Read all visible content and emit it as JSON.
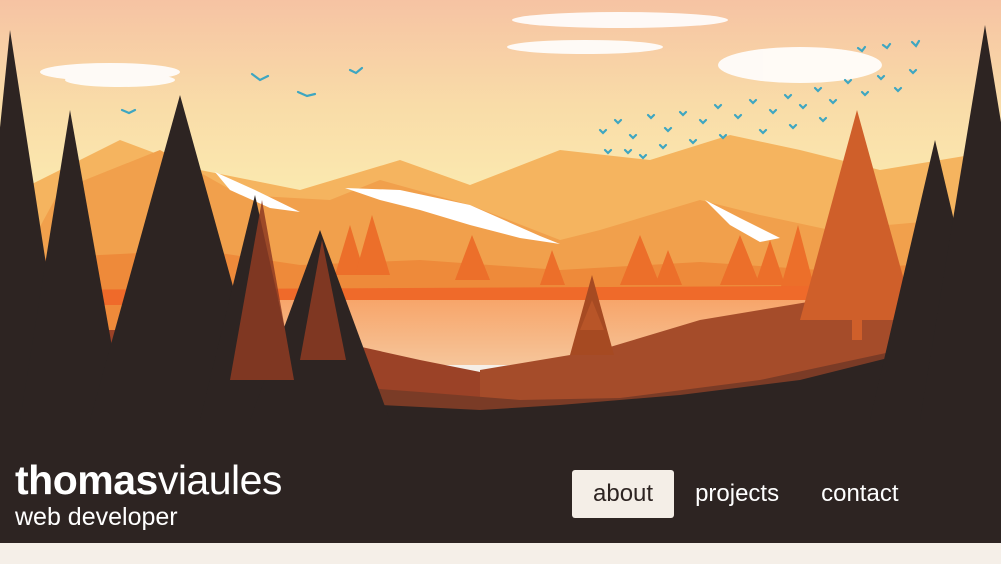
{
  "brand": {
    "first": "thomas",
    "last": "viaules",
    "tagline": "web developer"
  },
  "nav": {
    "items": [
      {
        "label": "about",
        "active": true
      },
      {
        "label": "projects",
        "active": false
      },
      {
        "label": "contact",
        "active": false
      }
    ]
  },
  "colors": {
    "ground": "#2d2422",
    "page_background": "#f5efe8",
    "sky_top": "#f6c6a4",
    "sky_horizon": "#fbe8a8",
    "mountain": "#f0a24e",
    "birds": "#3ea6c1"
  }
}
